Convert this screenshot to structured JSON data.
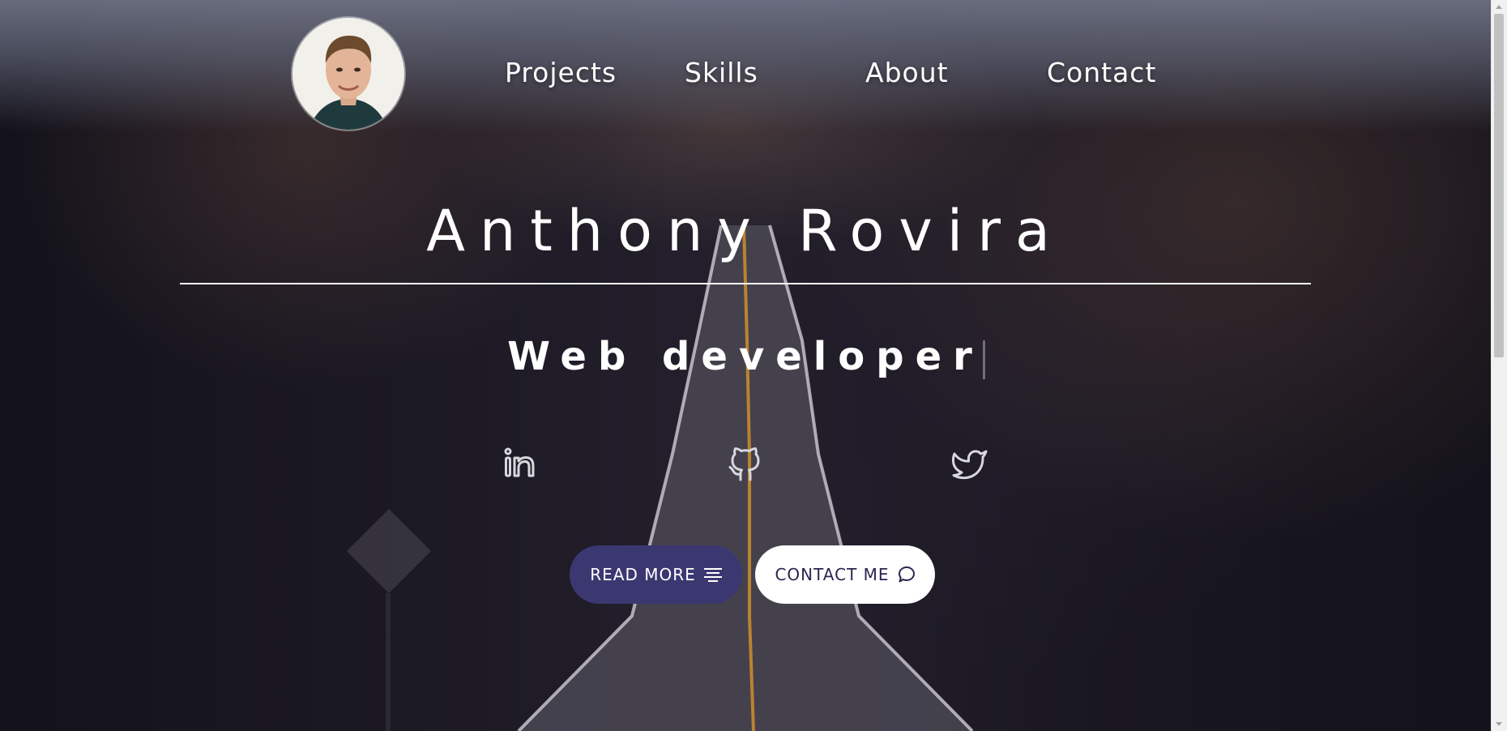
{
  "nav": {
    "links": [
      {
        "label": "Projects"
      },
      {
        "label": "Skills"
      },
      {
        "label": "About"
      },
      {
        "label": "Contact"
      }
    ]
  },
  "hero": {
    "name": "Anthony Rovira",
    "role": "Web developer"
  },
  "social": [
    {
      "icon": "linkedin-icon"
    },
    {
      "icon": "github-icon"
    },
    {
      "icon": "twitter-icon"
    }
  ],
  "buttons": {
    "read_more": {
      "label": "READ MORE",
      "icon": "menu-lines-icon"
    },
    "contact_me": {
      "label": "CONTACT ME",
      "icon": "chat-bubble-icon"
    }
  },
  "colors": {
    "primary_button": "#3b3770",
    "secondary_button": "#ffffff",
    "text": "#ffffff"
  }
}
